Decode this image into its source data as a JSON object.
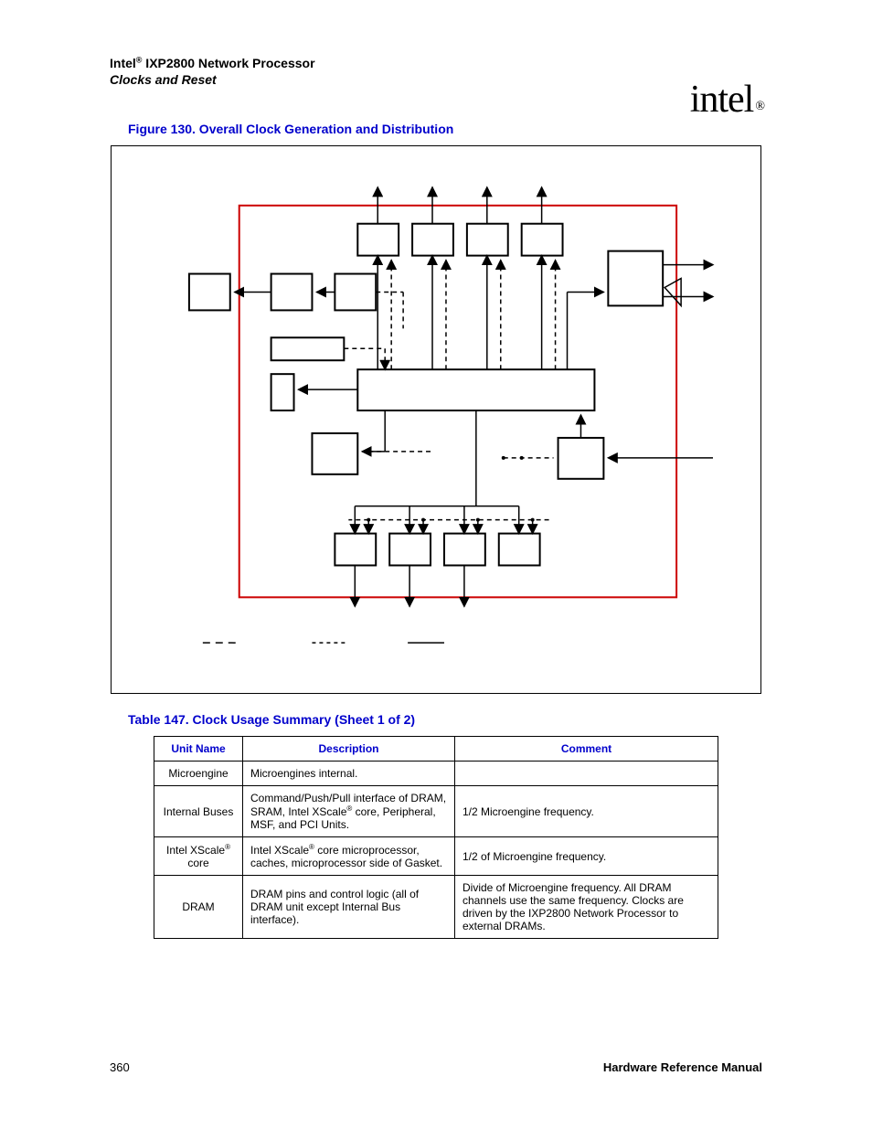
{
  "header": {
    "brand": "Intel",
    "reg": "®",
    "product": " IXP2800 Network Processor",
    "subtitle": "Clocks and Reset",
    "logo_text": "intel",
    "logo_reg": "®"
  },
  "figure": {
    "caption": "Figure 130. Overall Clock Generation and Distribution"
  },
  "table": {
    "caption": "Table 147. Clock Usage Summary (Sheet 1 of 2)",
    "headers": [
      "Unit Name",
      "Description",
      "Comment"
    ],
    "rows": [
      {
        "unit": "Microengine",
        "desc": "Microengines internal.",
        "comment": ""
      },
      {
        "unit": "Internal Buses",
        "desc": "Command/Push/Pull interface of DRAM, SRAM, Intel XScale® core, Peripheral, MSF, and PCI Units.",
        "comment": "1/2 Microengine frequency."
      },
      {
        "unit": "Intel XScale® core",
        "desc": "Intel XScale® core microprocessor, caches, microprocessor side of Gasket.",
        "comment": "1/2 of Microengine frequency."
      },
      {
        "unit": "DRAM",
        "desc": "DRAM pins and control logic (all of DRAM unit except Internal Bus interface).",
        "comment": "Divide of Microengine frequency. All DRAM channels use the same frequency. Clocks are driven by the IXP2800 Network Processor to external DRAMs."
      }
    ]
  },
  "footer": {
    "page_number": "360",
    "manual": "Hardware Reference Manual"
  }
}
